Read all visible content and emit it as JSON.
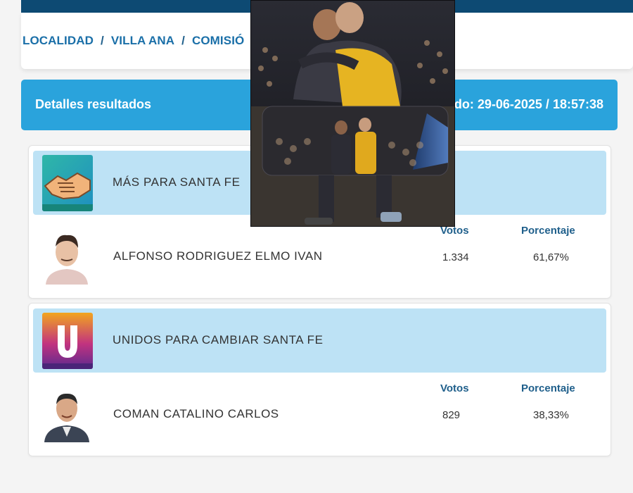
{
  "breadcrumb": {
    "items": [
      "LOCALIDAD",
      "VILLA ANA",
      "COMISIÓ"
    ],
    "separator": "/"
  },
  "header": {
    "title": "Detalles resultados",
    "date_text": "do: 29-06-2025 / 18:57:38"
  },
  "results": [
    {
      "party": "MÁS PARA SANTA FE",
      "party_logo_icon": "handshake-logo",
      "candidate": "ALFONSO RODRIGUEZ ELMO IVAN",
      "votos_label": "Votos",
      "porcentaje_label": "Porcentaje",
      "votos": "1.334",
      "porcentaje": "61,67%"
    },
    {
      "party": "UNIDOS PARA CAMBIAR SANTA FE",
      "party_logo_icon": "u-letter-logo",
      "candidate": "COMAN CATALINO CARLOS",
      "votos_label": "Votos",
      "porcentaje_label": "Porcentaje",
      "votos": "829",
      "porcentaje": "38,33%"
    }
  ],
  "colors": {
    "topbar": "#0d4a73",
    "header": "#2aa3dc",
    "party_band": "#bde2f5",
    "link": "#1a6fa8"
  }
}
